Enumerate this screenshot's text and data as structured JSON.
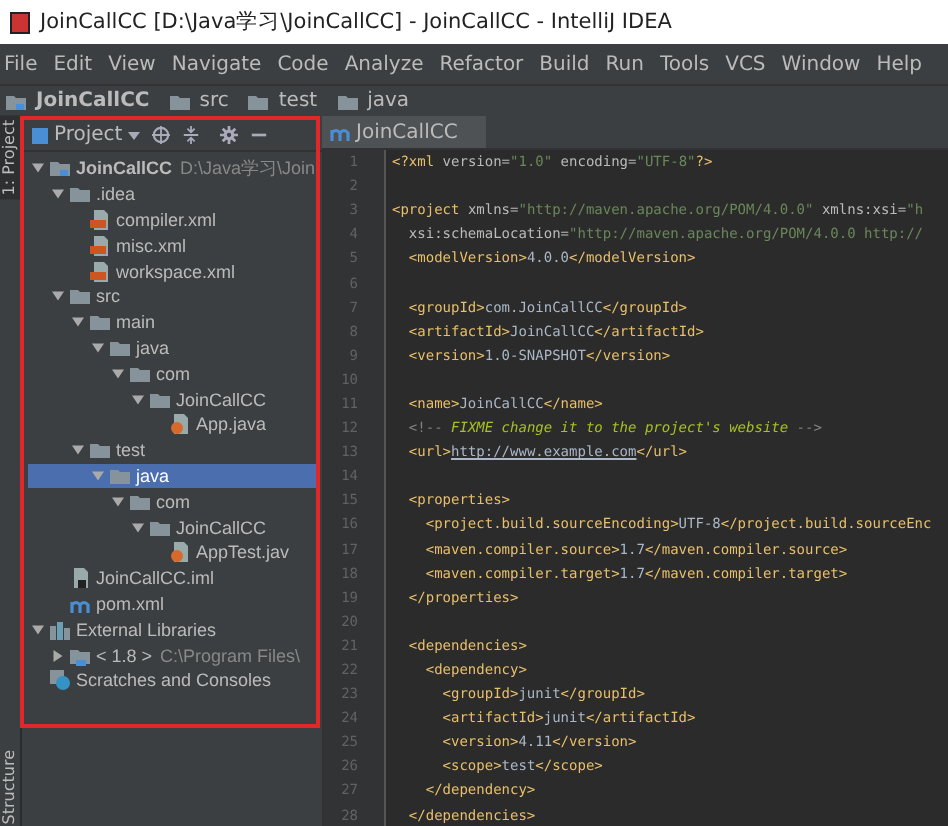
{
  "window": {
    "title": "JoinCallCC [D:\\Java学习\\JoinCallCC] - JoinCallCC - IntelliJ IDEA"
  },
  "menu": [
    "File",
    "Edit",
    "View",
    "Navigate",
    "Code",
    "Analyze",
    "Refactor",
    "Build",
    "Run",
    "Tools",
    "VCS",
    "Window",
    "Help"
  ],
  "breadcrumb": [
    {
      "label": "JoinCallCC",
      "kind": "module"
    },
    {
      "label": "src",
      "kind": "folder"
    },
    {
      "label": "test",
      "kind": "folder"
    },
    {
      "label": "java",
      "kind": "folder"
    }
  ],
  "side_strip": [
    "1: Project",
    "Structure"
  ],
  "project_panel": {
    "title": "Project",
    "tree": [
      {
        "label": "JoinCallCC",
        "hint": "D:\\Java学习\\Join",
        "kind": "module",
        "expanded": true,
        "selected": false,
        "children": [
          {
            "label": ".idea",
            "kind": "folder",
            "expanded": true,
            "selected": false,
            "children": [
              {
                "label": "compiler.xml",
                "kind": "xml",
                "selected": false
              },
              {
                "label": "misc.xml",
                "kind": "xml",
                "selected": false
              },
              {
                "label": "workspace.xml",
                "kind": "xml",
                "selected": false
              }
            ]
          },
          {
            "label": "src",
            "kind": "folder",
            "expanded": true,
            "selected": false,
            "children": [
              {
                "label": "main",
                "kind": "folder",
                "expanded": true,
                "selected": false,
                "children": [
                  {
                    "label": "java",
                    "kind": "folder",
                    "expanded": true,
                    "selected": false,
                    "children": [
                      {
                        "label": "com",
                        "kind": "folder",
                        "expanded": true,
                        "selected": false,
                        "children": [
                          {
                            "label": "JoinCallCC",
                            "kind": "folder",
                            "expanded": true,
                            "selected": false,
                            "children": [
                              {
                                "label": "App.java",
                                "kind": "java",
                                "selected": false
                              }
                            ]
                          }
                        ]
                      }
                    ]
                  }
                ]
              },
              {
                "label": "test",
                "kind": "folder",
                "expanded": true,
                "selected": false,
                "children": [
                  {
                    "label": "java",
                    "kind": "folder",
                    "expanded": true,
                    "selected": true,
                    "children": [
                      {
                        "label": "com",
                        "kind": "folder",
                        "expanded": true,
                        "selected": false,
                        "children": [
                          {
                            "label": "JoinCallCC",
                            "kind": "folder",
                            "expanded": true,
                            "selected": false,
                            "children": [
                              {
                                "label": "AppTest.jav",
                                "kind": "java",
                                "selected": false
                              }
                            ]
                          }
                        ]
                      }
                    ]
                  }
                ]
              }
            ]
          },
          {
            "label": "JoinCallCC.iml",
            "kind": "iml",
            "selected": false
          },
          {
            "label": "pom.xml",
            "kind": "pom",
            "selected": false
          }
        ]
      },
      {
        "label": "External Libraries",
        "kind": "libs",
        "expanded": true,
        "selected": false,
        "children": [
          {
            "label": "< 1.8 >",
            "hint": "C:\\Program Files\\",
            "kind": "jdk",
            "expanded": false,
            "selected": false
          }
        ]
      },
      {
        "label": "Scratches and Consoles",
        "kind": "scratches",
        "selected": false
      }
    ]
  },
  "editor": {
    "tabs": [
      {
        "label": "JoinCallCC",
        "selected": true
      }
    ],
    "lines": [
      {
        "number": "1",
        "tokens": [
          {
            "kind": "tag",
            "text": "<?xml "
          },
          {
            "kind": "attr",
            "text": "version="
          },
          {
            "kind": "value",
            "text": "\"1.0\""
          },
          {
            "kind": "attr",
            "text": " encoding="
          },
          {
            "kind": "value",
            "text": "\"UTF-8\""
          },
          {
            "kind": "tag",
            "text": "?>"
          }
        ]
      },
      {
        "number": "2"
      },
      {
        "number": "3",
        "tokens": [
          {
            "kind": "tag",
            "text": "<project "
          },
          {
            "kind": "attr",
            "text": "xmlns="
          },
          {
            "kind": "value",
            "text": "\"http://maven.apache.org/POM/4.0.0\""
          },
          {
            "kind": "attr",
            "text": " xmlns:xsi="
          },
          {
            "kind": "value",
            "text": "\"h"
          }
        ]
      },
      {
        "number": "4",
        "tokens": [
          {
            "kind": "attr",
            "text": "  xsi:schemaLocation="
          },
          {
            "kind": "value",
            "text": "\"http://maven.apache.org/POM/4.0.0 http://"
          }
        ]
      },
      {
        "number": "5",
        "tokens": [
          {
            "kind": "tag",
            "text": "  <modelVersion>"
          },
          {
            "kind": "text",
            "text": "4.0.0"
          },
          {
            "kind": "tag",
            "text": "</modelVersion>"
          }
        ]
      },
      {
        "number": "6"
      },
      {
        "number": "7",
        "tokens": [
          {
            "kind": "tag",
            "text": "  <groupId>"
          },
          {
            "kind": "text",
            "text": "com.JoinCallCC"
          },
          {
            "kind": "tag",
            "text": "</groupId>"
          }
        ]
      },
      {
        "number": "8",
        "tokens": [
          {
            "kind": "tag",
            "text": "  <artifactId>"
          },
          {
            "kind": "text",
            "text": "JoinCallCC"
          },
          {
            "kind": "tag",
            "text": "</artifactId>"
          }
        ]
      },
      {
        "number": "9",
        "tokens": [
          {
            "kind": "tag",
            "text": "  <version>"
          },
          {
            "kind": "text",
            "text": "1.0-SNAPSHOT"
          },
          {
            "kind": "tag",
            "text": "</version>"
          }
        ]
      },
      {
        "number": "10"
      },
      {
        "number": "11",
        "tokens": [
          {
            "kind": "tag",
            "text": "  <name>"
          },
          {
            "kind": "text",
            "text": "JoinCallCC"
          },
          {
            "kind": "tag",
            "text": "</name>"
          }
        ]
      },
      {
        "number": "12",
        "tokens": [
          {
            "kind": "comment",
            "text": "  <!-- "
          },
          {
            "kind": "todo",
            "text": "FIXME change it to the project's website"
          },
          {
            "kind": "comment",
            "text": " -->"
          }
        ]
      },
      {
        "number": "13",
        "tokens": [
          {
            "kind": "tag",
            "text": "  <url>"
          },
          {
            "kind": "link",
            "text": "http://www.example.com"
          },
          {
            "kind": "tag",
            "text": "</url>"
          }
        ]
      },
      {
        "number": "14"
      },
      {
        "number": "15",
        "tokens": [
          {
            "kind": "tag",
            "text": "  <properties>"
          }
        ]
      },
      {
        "number": "16",
        "tokens": [
          {
            "kind": "tag",
            "text": "    <project.build.sourceEncoding>"
          },
          {
            "kind": "text",
            "text": "UTF-8"
          },
          {
            "kind": "tag",
            "text": "</project.build.sourceEnc"
          }
        ]
      },
      {
        "number": "17",
        "tokens": [
          {
            "kind": "tag",
            "text": "    <maven.compiler.source>"
          },
          {
            "kind": "text",
            "text": "1.7"
          },
          {
            "kind": "tag",
            "text": "</maven.compiler.source>"
          }
        ]
      },
      {
        "number": "18",
        "tokens": [
          {
            "kind": "tag",
            "text": "    <maven.compiler.target>"
          },
          {
            "kind": "text",
            "text": "1.7"
          },
          {
            "kind": "tag",
            "text": "</maven.compiler.target>"
          }
        ]
      },
      {
        "number": "19",
        "tokens": [
          {
            "kind": "tag",
            "text": "  </properties>"
          }
        ]
      },
      {
        "number": "20"
      },
      {
        "number": "21",
        "tokens": [
          {
            "kind": "tag",
            "text": "  <dependencies>"
          }
        ]
      },
      {
        "number": "22",
        "tokens": [
          {
            "kind": "tag",
            "text": "    <dependency>"
          }
        ]
      },
      {
        "number": "23",
        "tokens": [
          {
            "kind": "tag",
            "text": "      <groupId>"
          },
          {
            "kind": "text",
            "text": "junit"
          },
          {
            "kind": "tag",
            "text": "</groupId>"
          }
        ]
      },
      {
        "number": "24",
        "tokens": [
          {
            "kind": "tag",
            "text": "      <artifactId>"
          },
          {
            "kind": "text",
            "text": "junit"
          },
          {
            "kind": "tag",
            "text": "</artifactId>"
          }
        ]
      },
      {
        "number": "25",
        "tokens": [
          {
            "kind": "tag",
            "text": "      <version>"
          },
          {
            "kind": "text",
            "text": "4.11"
          },
          {
            "kind": "tag",
            "text": "</version>"
          }
        ]
      },
      {
        "number": "26",
        "tokens": [
          {
            "kind": "tag",
            "text": "      <scope>"
          },
          {
            "kind": "text",
            "text": "test"
          },
          {
            "kind": "tag",
            "text": "</scope>"
          }
        ]
      },
      {
        "number": "27",
        "tokens": [
          {
            "kind": "tag",
            "text": "    </dependency>"
          }
        ]
      },
      {
        "number": "28",
        "tokens": [
          {
            "kind": "tag",
            "text": "  </dependencies>"
          }
        ]
      }
    ]
  }
}
